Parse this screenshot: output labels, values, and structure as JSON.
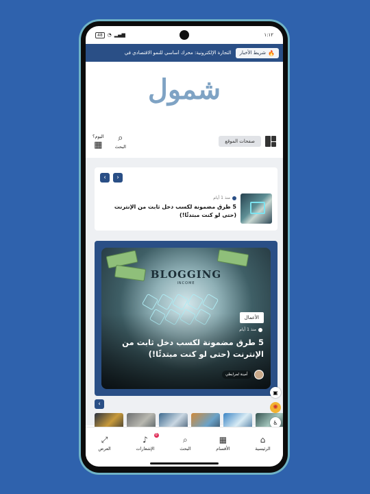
{
  "statusbar": {
    "time": "١:١٢",
    "battery": "48"
  },
  "ticker": {
    "label": "شريط الأخبار",
    "headline": "التجارة الإلكترونية: محرك أساسي للنمو الاقتصادي في"
  },
  "logo": {
    "text": "شمول"
  },
  "toolbar": {
    "site_pages_label": "صفحات الموقع",
    "search_label": "البحث",
    "today_label": "اليوم؟"
  },
  "mini_post": {
    "time_ago": "منذ 1 أيام",
    "title": "5 طرق مضمونة لكسب دخل ثابت من الإنترنت (حتى لو كنت مبتدئًا!)"
  },
  "featured": {
    "image_heading": "BLOGGING",
    "image_subheading": "INCOME",
    "category": "الأعمال",
    "time_ago": "منذ 1 أيام",
    "title": "5 طرق مضمونة لكسب دخل ثابت من الإنترنت (حتى لو كنت مبتدئًا!)",
    "author": "أمينة لمرابطي"
  },
  "bottom_nav": {
    "items": [
      {
        "label": "الرئيسية",
        "icon": "home-icon"
      },
      {
        "label": "الأقسام",
        "icon": "grid-icon"
      },
      {
        "label": "البحث",
        "icon": "search-icon"
      },
      {
        "label": "الإشعارات",
        "icon": "bell-icon",
        "badge": "0"
      },
      {
        "label": "العرض",
        "icon": "expand-icon"
      }
    ]
  },
  "colors": {
    "background": "#2f62ad",
    "primary": "#2a4f86",
    "frame": "#6fb3c6",
    "logo": "#7fa3c4"
  }
}
